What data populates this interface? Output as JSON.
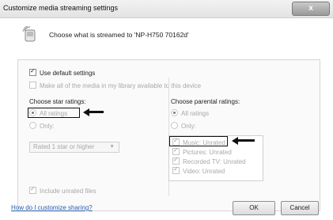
{
  "window": {
    "title": "Customize media streaming settings",
    "close_glyph": "x"
  },
  "header": {
    "icon": "media-device-icon",
    "text": "Choose what is streamed to 'NP-H750 70162d'"
  },
  "options": {
    "use_default": {
      "label": "Use default settings",
      "checked": true
    },
    "make_all": {
      "label": "Make all of the media in my library available to this device",
      "checked": false
    }
  },
  "star_ratings": {
    "heading": "Choose star ratings:",
    "all_label": "All ratings",
    "only_label": "Only:",
    "select_value": "Rated 1 star or higher",
    "include_unrated": "Include unrated files"
  },
  "parental": {
    "heading": "Choose parental ratings:",
    "all_label": "All ratings",
    "only_label": "Only:",
    "items": [
      {
        "label": "Music: Unrated",
        "checked": true
      },
      {
        "label": "Pictures: Unrated",
        "checked": true
      },
      {
        "label": "Recorded TV: Unrated",
        "checked": true
      },
      {
        "label": "Video: Unrated",
        "checked": true
      }
    ]
  },
  "footer": {
    "help_link": "How do I customize sharing?",
    "ok": "OK",
    "cancel": "Cancel"
  },
  "colors": {
    "link": "#2a5db0",
    "highlight_border": "#111111"
  }
}
